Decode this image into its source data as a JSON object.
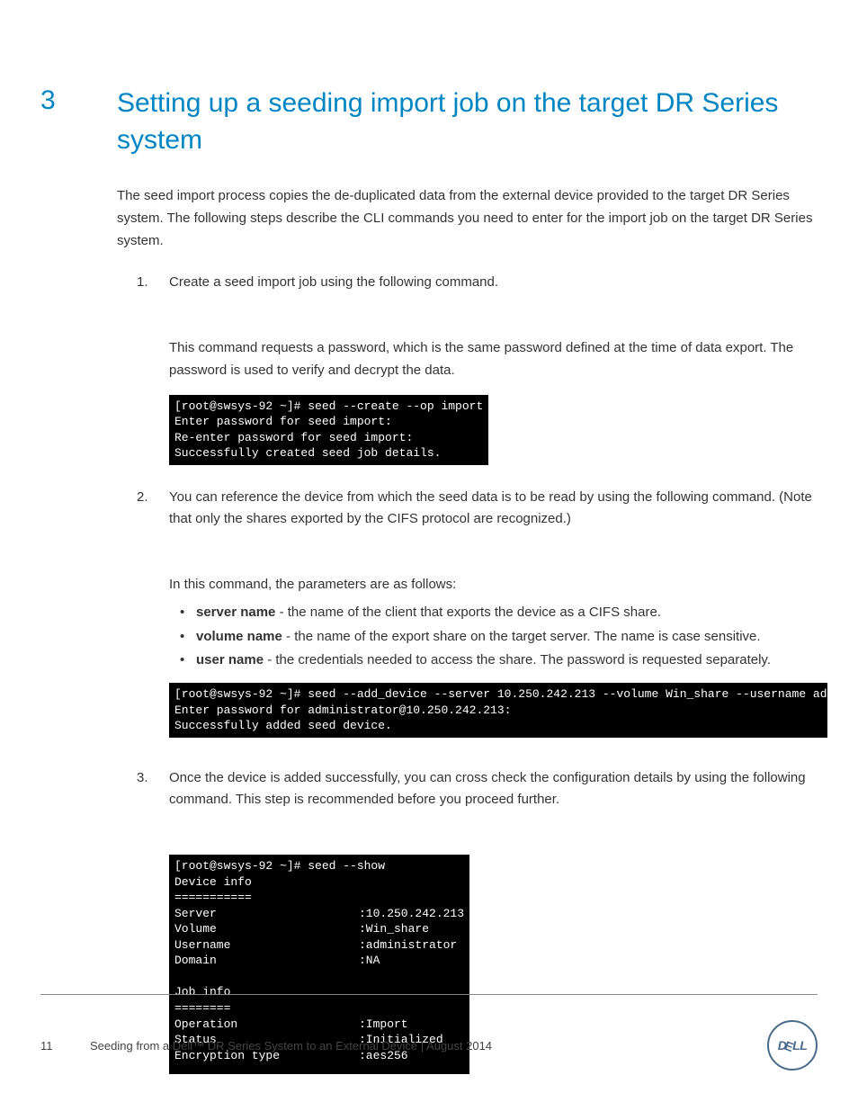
{
  "section": {
    "number": "3",
    "title": "Setting up a seeding import job on the target DR Series system"
  },
  "intro": "The seed import process copies the de-duplicated data from the external device provided to the target DR Series system. The following steps describe the CLI commands you need to enter for the import job on the target DR Series system.",
  "steps": {
    "s1": {
      "lead": "Create a seed import job using the following command.",
      "sub": "This command requests a password, which is the same password defined at the time of data export. The password is used to verify and decrypt the data.",
      "term": "[root@swsys-92 ~]# seed --create --op import\nEnter password for seed import:\nRe-enter password for seed import:\nSuccessfully created seed job details."
    },
    "s2": {
      "lead": "You can reference the device from which the seed data is to be read by using the following command. (Note that only the shares exported by the CIFS protocol are recognized.)",
      "sub": "In this command, the parameters are as follows:",
      "params": {
        "p1_name": "server name",
        "p1_desc": " - the name of the client that exports the device as a CIFS share.",
        "p2_name": "volume name",
        "p2_desc": " - the name of the export share on the target server. The name is case sensitive.",
        "p3_name": "user name",
        "p3_desc": " - the credentials needed to access the share. The password is requested separately."
      },
      "term": "[root@swsys-92 ~]# seed --add_device --server 10.250.242.213 --volume Win_share --username administrator\nEnter password for administrator@10.250.242.213:\nSuccessfully added seed device."
    },
    "s3": {
      "lead": "Once the device is added successfully, you can cross check the configuration details by using the following command. This step is recommended before you proceed further.",
      "term_cmd": "[root@swsys-92 ~]# seed --show",
      "term_h1": "Device info",
      "term_u1": "===========",
      "rows": {
        "r1k": "Server",
        "r1v": ":10.250.242.213",
        "r2k": "Volume",
        "r2v": ":Win_share",
        "r3k": "Username",
        "r3v": ":administrator",
        "r4k": "Domain",
        "r4v": ":NA"
      },
      "term_h2": "Job info",
      "term_u2": "========",
      "rows2": {
        "r1k": "Operation",
        "r1v": ":Import",
        "r2k": "Status",
        "r2v": ":Initialized",
        "r3k": "Encryption type",
        "r3v": ":aes256"
      }
    }
  },
  "footer": {
    "page": "11",
    "text": "Seeding from a Dell™ DR Series System to an External Device | August 2014"
  }
}
